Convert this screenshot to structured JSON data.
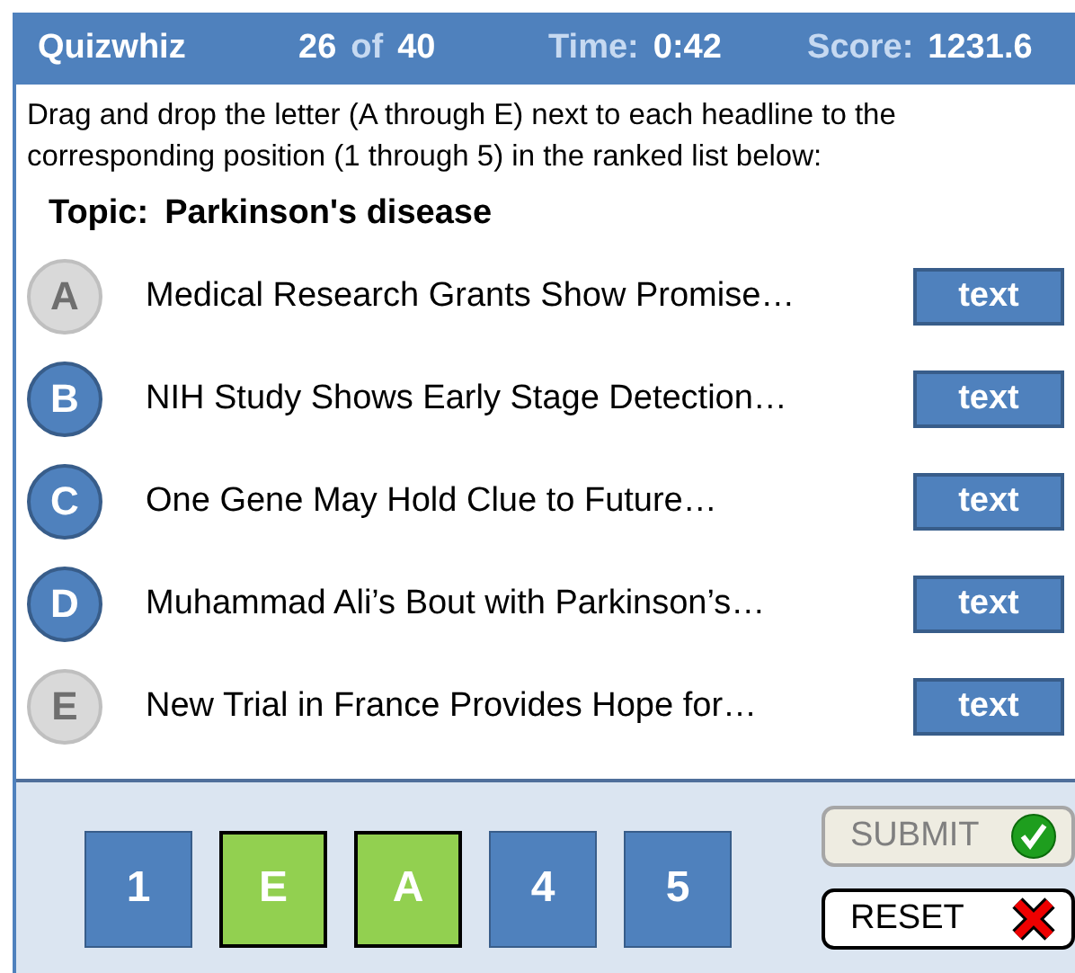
{
  "header": {
    "app_name": "Quizwhiz",
    "question_current": "26",
    "question_of": "of",
    "question_total": "40",
    "time_label": "Time:",
    "time_value": "0:42",
    "score_label": "Score:",
    "score_value": "1231.6"
  },
  "instructions": "Drag and drop the letter (A through E) next to each headline to the corresponding position (1 through 5) in the ranked list below:",
  "topic": {
    "label": "Topic:",
    "value": "Parkinson's disease"
  },
  "headlines": [
    {
      "letter": "A",
      "used": true,
      "text": "Medical Research Grants Show Promise…",
      "button": "text"
    },
    {
      "letter": "B",
      "used": false,
      "text": "NIH Study Shows Early Stage Detection…",
      "button": "text"
    },
    {
      "letter": "C",
      "used": false,
      "text": "One Gene May Hold Clue to Future…",
      "button": "text"
    },
    {
      "letter": "D",
      "used": false,
      "text": "Muhammad Ali’s Bout with Parkinson’s…",
      "button": "text"
    },
    {
      "letter": "E",
      "used": true,
      "text": "New Trial in France Provides Hope for…",
      "button": "text"
    }
  ],
  "slots": [
    {
      "label": "1",
      "kind": "empty"
    },
    {
      "label": "E",
      "kind": "filled"
    },
    {
      "label": "A",
      "kind": "filled"
    },
    {
      "label": "4",
      "kind": "empty"
    },
    {
      "label": "5",
      "kind": "empty"
    }
  ],
  "submit": {
    "label": "SUBMIT",
    "disabled": true
  },
  "reset": {
    "label": "RESET"
  }
}
